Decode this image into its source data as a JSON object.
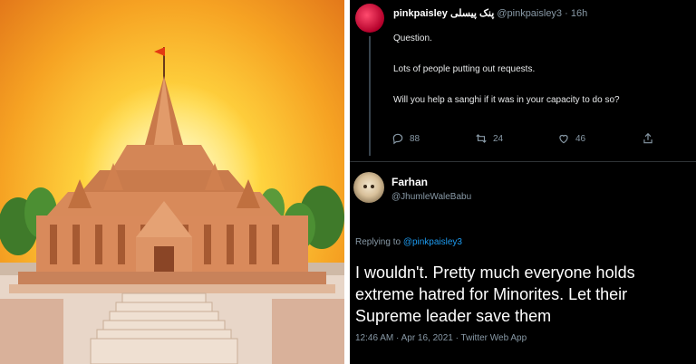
{
  "left_image": {
    "alt": ""
  },
  "tweet1": {
    "display_name": "pinkpaisley",
    "urdu_name": "پنک پیسلی",
    "handle": "@pinkpaisley3",
    "time": "· 16h",
    "lines": [
      "Question.",
      "Lots of people putting out requests.",
      "Will you help a sanghi if it was in your capacity to do so?"
    ],
    "replies": "88",
    "retweets": "24",
    "likes": "46"
  },
  "tweet2": {
    "display_name": "Farhan",
    "handle": "@JhumleWaleBabu",
    "replying_prefix": "Replying to ",
    "replying_to": "@pinkpaisley3",
    "body": "I wouldn't. Pretty much everyone holds extreme hatred for Minorites. Let their Supreme leader save them",
    "footer": "12:46 AM · Apr 16, 2021 · Twitter Web App"
  },
  "colors": {
    "link": "#1d9bf0",
    "muted": "#8899a6",
    "temple": "#d98a5b"
  },
  "icons": [
    "reply-icon",
    "retweet-icon",
    "like-icon",
    "share-icon"
  ]
}
